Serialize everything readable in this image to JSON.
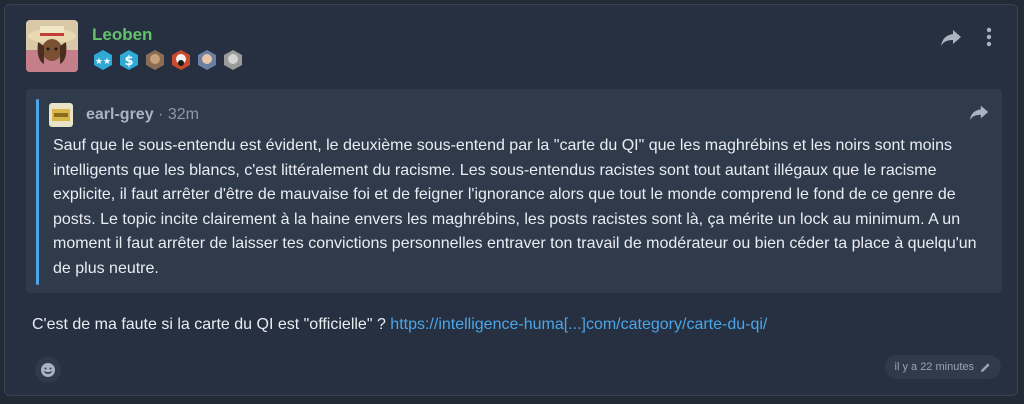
{
  "post": {
    "username": "Leoben",
    "badges": [
      {
        "icon": "double-star-icon",
        "color": "#2fa9d6"
      },
      {
        "icon": "dollar-icon",
        "color": "#2fa9d6"
      },
      {
        "icon": "avatar-badge-icon",
        "color": "#8a6d55"
      },
      {
        "icon": "avatar-badge-icon",
        "color": "#c94a2c"
      },
      {
        "icon": "avatar-badge-icon",
        "color": "#6d7fa3"
      },
      {
        "icon": "avatar-badge-icon",
        "color": "#9b9b9b"
      }
    ],
    "quote": {
      "author": "earl-grey",
      "separator": "·",
      "time": "32m",
      "text": "Sauf que le sous-entendu est évident, le deuxième sous-entend par la \"carte du QI\" que les maghrébins et les noirs sont moins intelligents que les blancs, c'est littéralement du racisme. Les sous-entendus racistes sont tout autant illégaux que le racisme explicite, il faut arrêter d'être de mauvaise foi et de feigner l'ignorance alors que tout le monde comprend le fond de ce genre de posts. Le topic incite clairement à la haine envers les maghrébins, les posts racistes sont là, ça mérite un lock au minimum. A un moment il faut arrêter de laisser tes convictions personnelles entraver ton travail de modérateur ou bien céder ta place à quelqu'un de plus neutre."
    },
    "reply": {
      "text": "C'est de ma faute si la carte du QI est \"officielle\" ?",
      "link_text": "https://intelligence-huma[...]com/category/carte-du-qi/"
    },
    "footer": {
      "edited_time": "il y a 22 minutes"
    }
  },
  "colors": {
    "background": "#222a36",
    "card": "#263041",
    "quote_bg": "#2f3a4b",
    "accent": "#4ba6e8",
    "username": "#62c26a"
  }
}
